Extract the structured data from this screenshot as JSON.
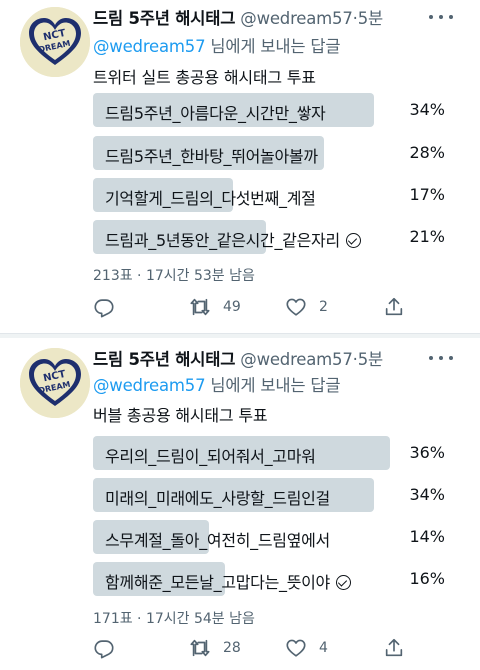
{
  "tweets": [
    {
      "author": {
        "name": "드림 5주년 해시태그",
        "handle": "@wedream57",
        "time": "5분"
      },
      "reply": {
        "mention": "@wedream57",
        "suffix": "님에게 보내는 답글"
      },
      "text": "트위터 실트 총공용 해시태그 투표",
      "poll": [
        {
          "label": "드림5주년_아름다운_시간만_쌓자",
          "pct": "34%",
          "fill": 0.34,
          "selected": false
        },
        {
          "label": "드림5주년_한바탕_뛰어놀아볼까",
          "pct": "28%",
          "fill": 0.28,
          "selected": false
        },
        {
          "label": "기억할게_드림의_다섯번째_계절",
          "pct": "17%",
          "fill": 0.17,
          "selected": false
        },
        {
          "label": "드림과_5년동안_같은시간_같은자리",
          "pct": "21%",
          "fill": 0.21,
          "selected": true
        }
      ],
      "meta": "213표 · 17시간 53분 남음",
      "stats": {
        "replies": "",
        "retweets": "49",
        "likes": "2"
      }
    },
    {
      "author": {
        "name": "드림 5주년 해시태그",
        "handle": "@wedream57",
        "time": "5분"
      },
      "reply": {
        "mention": "@wedream57",
        "suffix": "님에게 보내는 답글"
      },
      "text": "버블 총공용 해시태그 투표",
      "poll": [
        {
          "label": "우리의_드림이_되어줘서_고마워",
          "pct": "36%",
          "fill": 0.36,
          "selected": false
        },
        {
          "label": "미래의_미래에도_사랑할_드림인걸",
          "pct": "34%",
          "fill": 0.34,
          "selected": false
        },
        {
          "label": "스무계절_돌아_여전히_드림옆에서",
          "pct": "14%",
          "fill": 0.14,
          "selected": false
        },
        {
          "label": "함께해준_모든날_고맙다는_뜻이야",
          "pct": "16%",
          "fill": 0.16,
          "selected": true
        }
      ],
      "meta": "171표 · 17시간 54분 남음",
      "stats": {
        "replies": "",
        "retweets": "28",
        "likes": "4"
      }
    }
  ],
  "avatar": {
    "logo_text": "NCT DREAM",
    "bg": "#ece7c6",
    "heart": "#1e2f6e"
  },
  "colors": {
    "link": "#1d9bf0",
    "muted": "#536471",
    "bar": "#cfd9de",
    "separator": "#eff3f4"
  }
}
